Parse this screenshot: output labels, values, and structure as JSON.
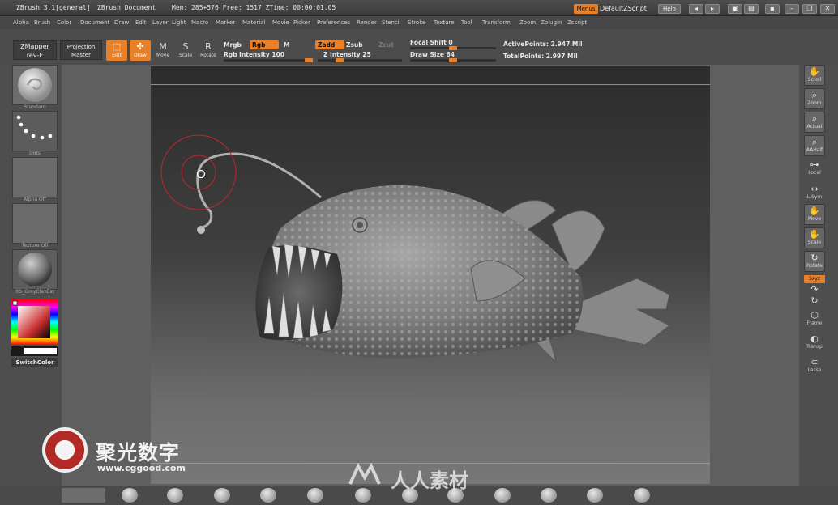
{
  "title_bar": {
    "app": "ZBrush  3.1[general]",
    "document": "ZBrush Document",
    "stats": "Mem: 285+576  Free: 1517  ZTime: 00:00:01.05",
    "menus_button": "Menus",
    "script_name": "DefaultZScript",
    "help_button": "Help"
  },
  "menu_bar": [
    "Alpha",
    "Brush",
    "Color",
    "Document",
    "Draw",
    "Edit",
    "Layer",
    "Light",
    "Macro",
    "Marker",
    "Material",
    "Movie",
    "Picker",
    "Preferences",
    "Render",
    "Stencil",
    "Stroke",
    "Texture",
    "Tool",
    "Transform",
    "Zoom",
    "Zplugin",
    "Zscript"
  ],
  "shelf": {
    "zmapper": "ZMapper",
    "zmapper_sub": "rev-E",
    "projection": "Projection",
    "projection_sub": "Master",
    "edit": "Edit",
    "draw": "Draw",
    "move": "Move",
    "scale": "Scale",
    "rotate": "Rotate",
    "mrgb": "Mrgb",
    "rgb": "Rgb",
    "m": "M",
    "rgb_intensity": "Rgb  Intensity 100",
    "zadd": "Zadd",
    "zsub": "Zsub",
    "zcut": "Zcut",
    "z_intensity": "Z  Intensity 25",
    "focal_shift": "Focal  Shift 0",
    "draw_size": "Draw  Size 64",
    "active_points": "ActivePoints: 2.947  Mil",
    "total_points": "TotalPoints: 2.997  Mil",
    "rgb_intensity_value": 100,
    "z_intensity_value": 25,
    "focal_shift_value": 0,
    "draw_size_value": 64
  },
  "left_tray": {
    "brush_label": "Standard",
    "stroke_label": "Dots",
    "alpha_label": "Alpha  Off",
    "texture_label": "Texture  Off",
    "material_label": "RS_GreyClayEst",
    "switch_color": "SwitchColor"
  },
  "right_tray": [
    "Scroll",
    "Zoom",
    "Actual",
    "AAHalf",
    "Local",
    "L.Sym",
    "Move",
    "Scale",
    "Rotate",
    "Frame",
    "Transp",
    "Lasso"
  ],
  "right_tray_xyz": "Sxyz",
  "watermark": {
    "cn_brand": "聚光数字",
    "url": "www.cggood.com",
    "cn_brand2": "人人素材"
  },
  "colors": {
    "accent": "#e8802a",
    "brush_ring": "#c0262c"
  }
}
